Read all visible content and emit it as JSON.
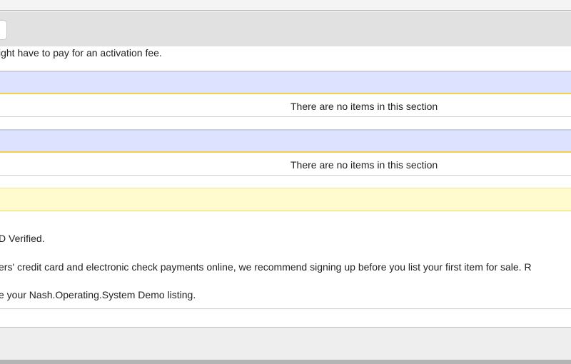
{
  "top_text": "ight have to pay for an activation fee.",
  "sections": [
    {
      "empty_message": "There are no items in this section"
    },
    {
      "empty_message": "There are no items in this section"
    }
  ],
  "notes": {
    "verified": "D Verified.",
    "payments": "ers' credit card and electronic check payments online, we recommend signing up before you list your first item for sale. R",
    "listing": "e your Nash.Operating.System Demo listing."
  }
}
